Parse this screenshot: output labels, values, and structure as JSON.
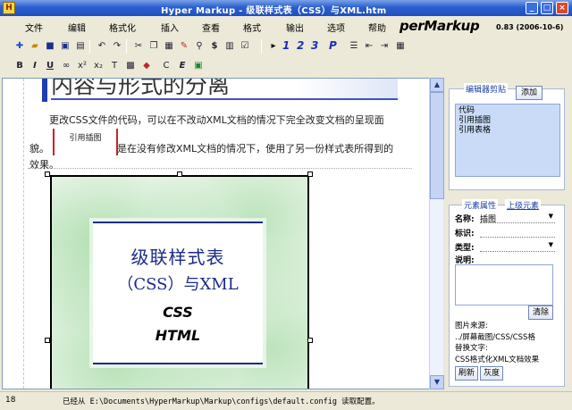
{
  "window": {
    "title": "Hyper Markup - 级联样式表（CSS）与XML.htm",
    "brand": "perMarkup",
    "version": "0.83 (2006-10-6)"
  },
  "menu": [
    "文件",
    "编辑",
    "格式化",
    "插入",
    "查看",
    "格式",
    "输出",
    "选项",
    "帮助"
  ],
  "toolbar": {
    "heading_labels": [
      "1",
      "2",
      "3",
      "P"
    ],
    "format_labels": [
      "B",
      "I",
      "U",
      "x²",
      "x₂",
      "C",
      "E"
    ]
  },
  "document": {
    "heading": "内容与形式的分离",
    "para1_line1": "更改CSS文件的代码，可以在不改动XML文档的情况下完全改变文档的呈现面",
    "para1_line2_start": "貌。",
    "pic_label": "引用插图",
    "para1_line2_end": "是在没有修改XML文档的情况下，使用了另一份样式表所得到的",
    "para1_line3": "效果。",
    "image": {
      "line1": "级联样式表",
      "line2": "（CSS）与XML",
      "line3": "CSS",
      "line4": "HTML"
    }
  },
  "clipboard": {
    "title": "编辑器剪贴",
    "add_label": "添加",
    "items": [
      "代码",
      "引用插图",
      "引用表格"
    ]
  },
  "properties": {
    "title": "元素属性",
    "parent_link": "上级元素",
    "name_label": "名称:",
    "name_value": "插图",
    "id_label": "标识:",
    "type_label": "类型:",
    "desc_label": "说明:",
    "clear_label": "清除",
    "source_label": "图片来源:",
    "source_value": "../屏幕截图/CSS/CSS格",
    "alt_label": "替换文字:",
    "alt_value": "CSS格式化XML文档效果",
    "refresh_label": "刷新",
    "gray_label": "灰度"
  },
  "status": {
    "line": "18",
    "message": "已经从 E:\\Documents\\HyperMarkup\\Markup\\configs\\default.config 读取配置。"
  },
  "colors": {
    "title_bar": "#2a5fcf",
    "heading_accent": "#1d3fb5",
    "pic_marker": "#c0272d",
    "clipboard_bg": "#c9dbf7"
  }
}
